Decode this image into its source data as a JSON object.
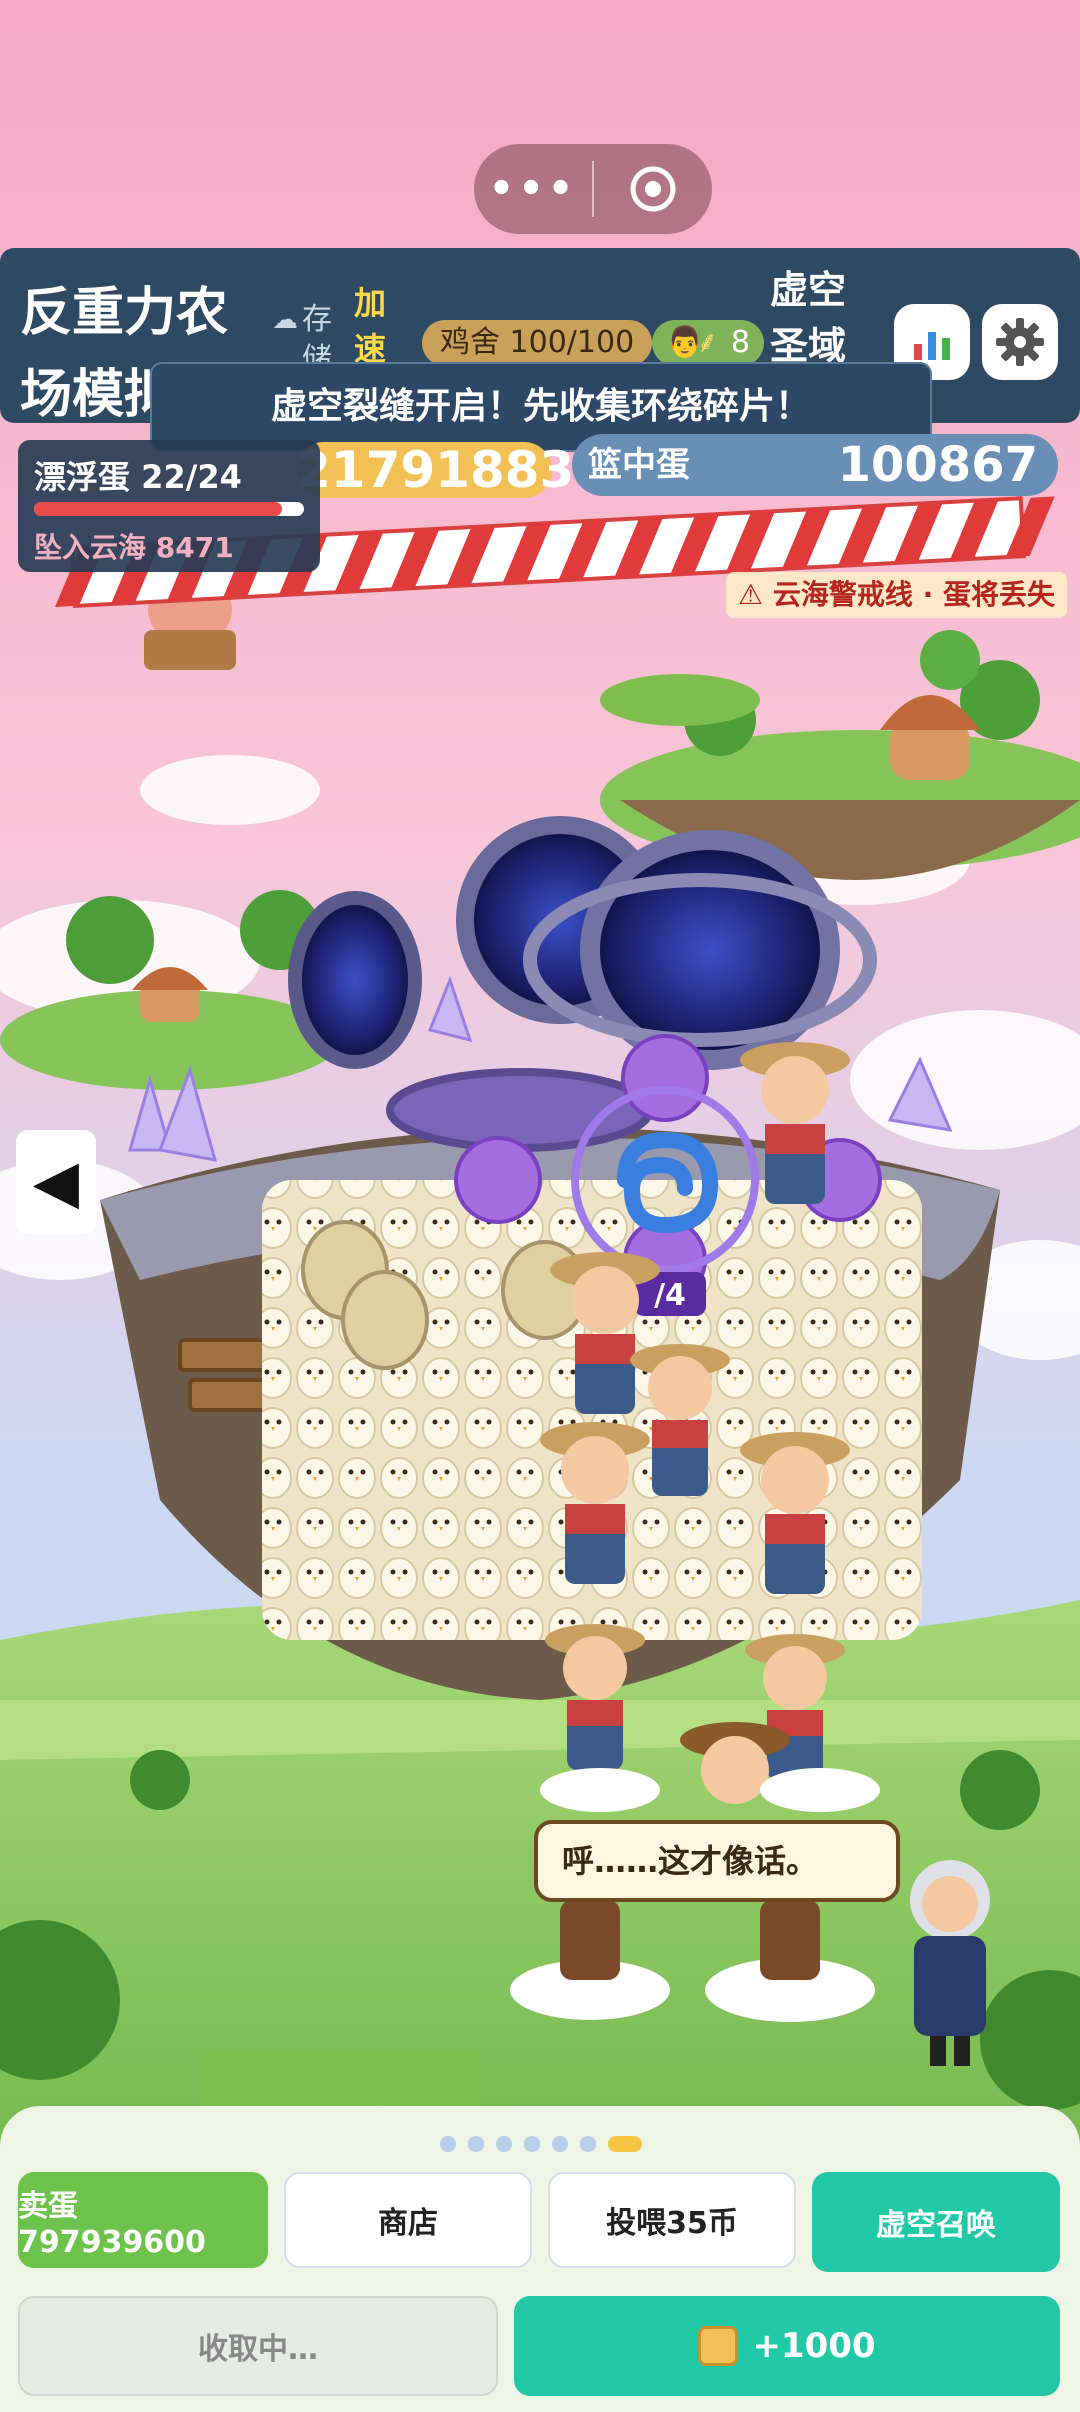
{
  "app": {
    "title": "反重力农场模拟器",
    "storage_label": "存储中",
    "speed_label": "加速",
    "coop": "鸡舍 100/100",
    "farmers": "8",
    "void_realm": "虚空圣域"
  },
  "banner": "虚空裂缝开启！先收集环绕碎片！",
  "floating_egg": {
    "label": "漂浮蛋 22/24",
    "progress": 0.917,
    "fall_label": "坠入云海 8471"
  },
  "coins": "217918830",
  "basket": {
    "label": "篮中蛋",
    "value": "100867"
  },
  "warning": "云海警戒线 · 蛋将丢失",
  "portal_counter": "/4",
  "speech": "呼……这才像话。",
  "page_dots": {
    "count": 7,
    "active": 6
  },
  "buttons": {
    "sell": "卖蛋 797939600",
    "shop": "商店",
    "feed": "投喂35币",
    "summon": "虚空召唤",
    "collect": "收取中…",
    "bonus": "+1000"
  },
  "colors": {
    "topbar": "#2e4a63",
    "sell": "#6cc24a",
    "teal": "#22c9a6",
    "coins": "#f2c055",
    "basket": "#6a8fb6",
    "warn": "#b3261e"
  },
  "icons": [
    "more-icon",
    "record-icon",
    "chart-icon",
    "gear-icon",
    "left-arrow-icon",
    "warning-icon",
    "farmer-icon",
    "wheat-icon",
    "coin-icon",
    "cloud-icon"
  ]
}
